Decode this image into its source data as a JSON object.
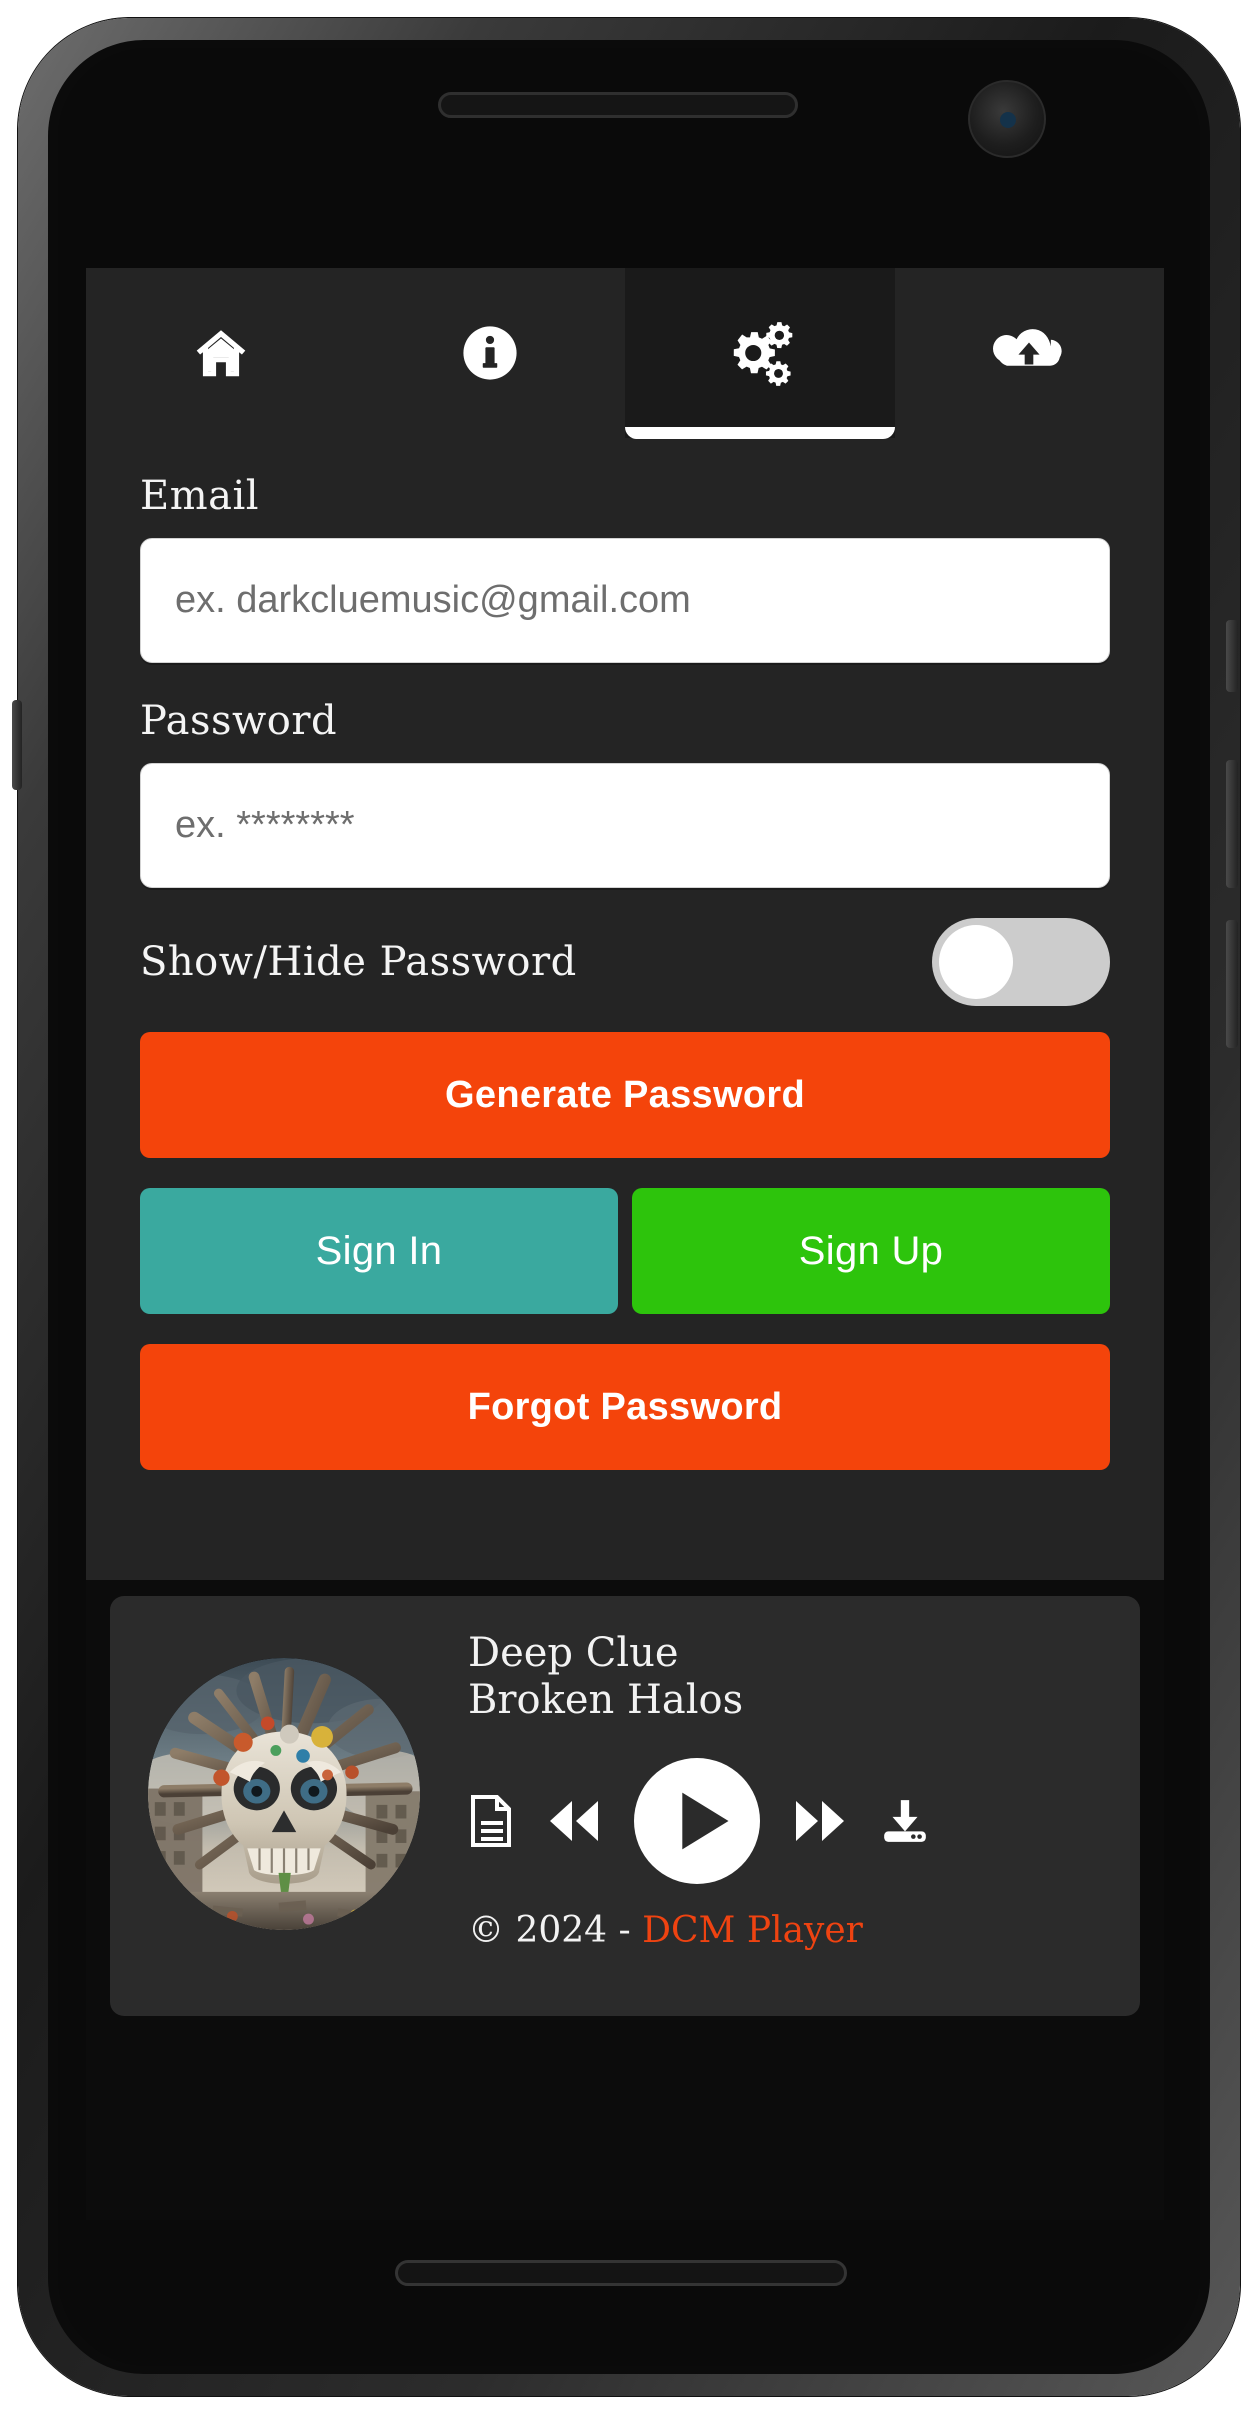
{
  "app": {
    "name": "DCM Player",
    "screen": "Settings / Account"
  },
  "colors": {
    "screen_bg": "#0c0c0c",
    "panel_bg": "#242424",
    "tab_active_bg": "#1a1a1a",
    "accent_orange": "#f4440b",
    "signin_teal": "#3aa99f",
    "signup_green": "#2dc40c",
    "toggle_track_off": "#cccccc",
    "toggle_knob": "#ffffff",
    "brand_orange": "#ef4311",
    "player_card_bg": "#2b2b2b",
    "text_primary": "#f2f2f2"
  },
  "tabs": [
    {
      "id": "home",
      "icon": "home-icon",
      "label": "Home",
      "active": false
    },
    {
      "id": "info",
      "icon": "info-circle-icon",
      "label": "Info",
      "active": false
    },
    {
      "id": "settings",
      "icon": "gears-icon",
      "label": "Settings",
      "active": true
    },
    {
      "id": "upload",
      "icon": "cloud-upload-icon",
      "label": "Upload",
      "active": false
    }
  ],
  "form": {
    "email": {
      "label": "Email",
      "value": "",
      "placeholder": "ex. darkcluemusic@gmail.com"
    },
    "password": {
      "label": "Password",
      "value": "",
      "placeholder": "ex. ********"
    },
    "show_hide_password": {
      "label": "Show/Hide Password",
      "state": "off"
    },
    "buttons": {
      "generate_password": "Generate Password",
      "sign_in": "Sign In",
      "sign_up": "Sign Up",
      "forgot_password": "Forgot Password"
    }
  },
  "player": {
    "album_art_alt": "skull-album-art",
    "artist": "Deep Clue",
    "track": "Broken Halos",
    "controls": [
      {
        "id": "lyrics",
        "icon": "document-icon"
      },
      {
        "id": "previous",
        "icon": "rewind-icon"
      },
      {
        "id": "play",
        "icon": "play-icon"
      },
      {
        "id": "next",
        "icon": "fast-forward-icon"
      },
      {
        "id": "download",
        "icon": "download-icon"
      }
    ],
    "copyright_prefix": "© 2024 - ",
    "copyright_brand": "DCM Player"
  }
}
